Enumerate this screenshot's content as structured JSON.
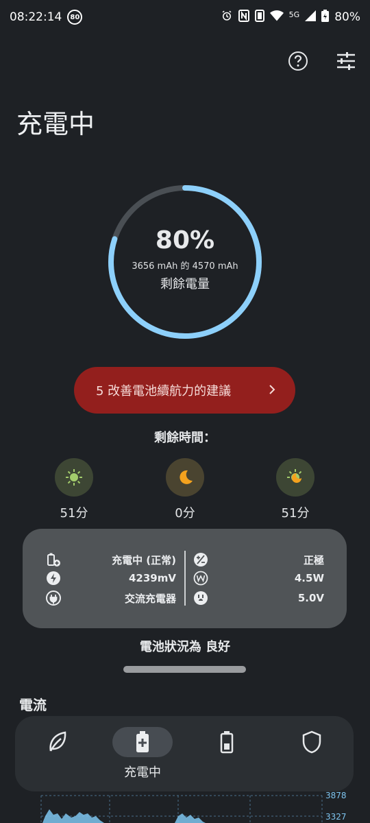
{
  "status_bar": {
    "time": "08:22:14",
    "badge": "80",
    "network": "5G",
    "battery": "80%"
  },
  "header": {
    "title": "充電中"
  },
  "battery": {
    "percent": "80%",
    "capacity_text": "3656 mAh 的 4570 mAh",
    "remaining_label": "剩餘電量",
    "level": 0.8,
    "ring_color": "#8dd0fb",
    "track_color": "#4a4f54"
  },
  "tips_button": {
    "label": "5 改善電池續航力的建議",
    "color": "#931f1d"
  },
  "remaining_time": {
    "label": "剩餘時間：",
    "modes": [
      {
        "icon": "sun-icon",
        "value": "51分"
      },
      {
        "icon": "moon-icon",
        "value": "0分"
      },
      {
        "icon": "sun-moon-icon",
        "value": "51分"
      }
    ]
  },
  "details": {
    "left": [
      {
        "icon": "battery-charging-icon",
        "text": "充電中 (正常)"
      },
      {
        "icon": "bolt-icon",
        "text": "4239mV"
      },
      {
        "icon": "plug-icon",
        "text": "交流充電器"
      }
    ],
    "right": [
      {
        "icon": "polarity-icon",
        "text": "正極"
      },
      {
        "icon": "watt-icon",
        "text": "4.5W"
      },
      {
        "icon": "outlet-icon",
        "text": "5.0V"
      }
    ]
  },
  "health": {
    "text": "電池狀況為 良好"
  },
  "section": {
    "title": "電流"
  },
  "chart_data": {
    "type": "area",
    "y_tick_labels": [
      "3878",
      "3327"
    ],
    "grid": true
  },
  "bottom_nav": {
    "items": [
      {
        "icon": "leaf-icon",
        "label": ""
      },
      {
        "icon": "battery-plus-icon",
        "label": "充電中",
        "active": true
      },
      {
        "icon": "battery-icon",
        "label": ""
      },
      {
        "icon": "shield-icon",
        "label": ""
      }
    ]
  }
}
